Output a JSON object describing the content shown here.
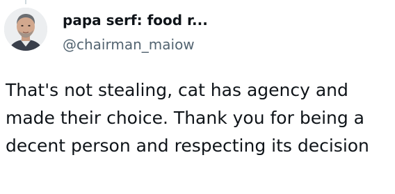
{
  "tweet": {
    "author": {
      "display_name": "papa serf: food r...",
      "handle": "@chairman_maiow",
      "avatar_icon": "user-avatar-photo"
    },
    "text": "That's not stealing, cat has agency and made their choice. Thank you for being a decent person and respecting its decision"
  },
  "colors": {
    "primary_text": "#0f1419",
    "secondary_text": "#536471",
    "background": "#ffffff",
    "thread_line": "#cfd9de"
  }
}
